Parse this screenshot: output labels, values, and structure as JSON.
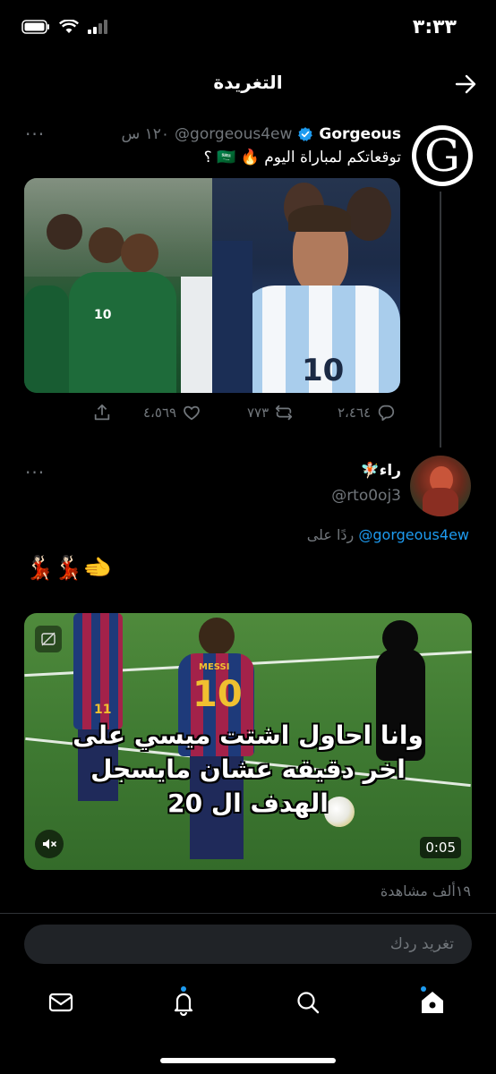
{
  "status_bar": {
    "time": "٣:٣٣"
  },
  "header": {
    "title": "التغريدة"
  },
  "tweet1": {
    "display_name": "Gorgeous",
    "handle": "@gorgeous4ew",
    "time": "١٢٠ س",
    "text": "توقعاتكم لمباراة اليوم 🔥 🇸🇦 ؟",
    "avatar_letter": "G",
    "comments": "٢،٤٦٤",
    "retweets": "٧٧٣",
    "likes": "٤،٥٦٩",
    "more": "···",
    "jersey_saudi": "10",
    "jersey_arg": "10"
  },
  "tweet2": {
    "display_name": "راء🧚🏻",
    "handle": "@rto0oj3",
    "reply_prefix": "ردًا على",
    "reply_to": "@gorgeous4ew",
    "emojis": "💃🏻💃🏻🫲",
    "more": "···",
    "video_caption_line1": "وانا احاول اشتت ميسي على",
    "video_caption_line2": "اخر دقيقه عشان مايسجل",
    "video_caption_line3": "الهدف ال 20",
    "video_duration": "0:05",
    "views": "١٩ألف مشاهدة",
    "player_name": "MESSI",
    "player_number": "10",
    "player2_number": "11"
  },
  "reply_box": {
    "placeholder": "تغريد ردك"
  },
  "colors": {
    "accent": "#1d9bf0",
    "background": "#000000",
    "muted": "#71767b"
  }
}
